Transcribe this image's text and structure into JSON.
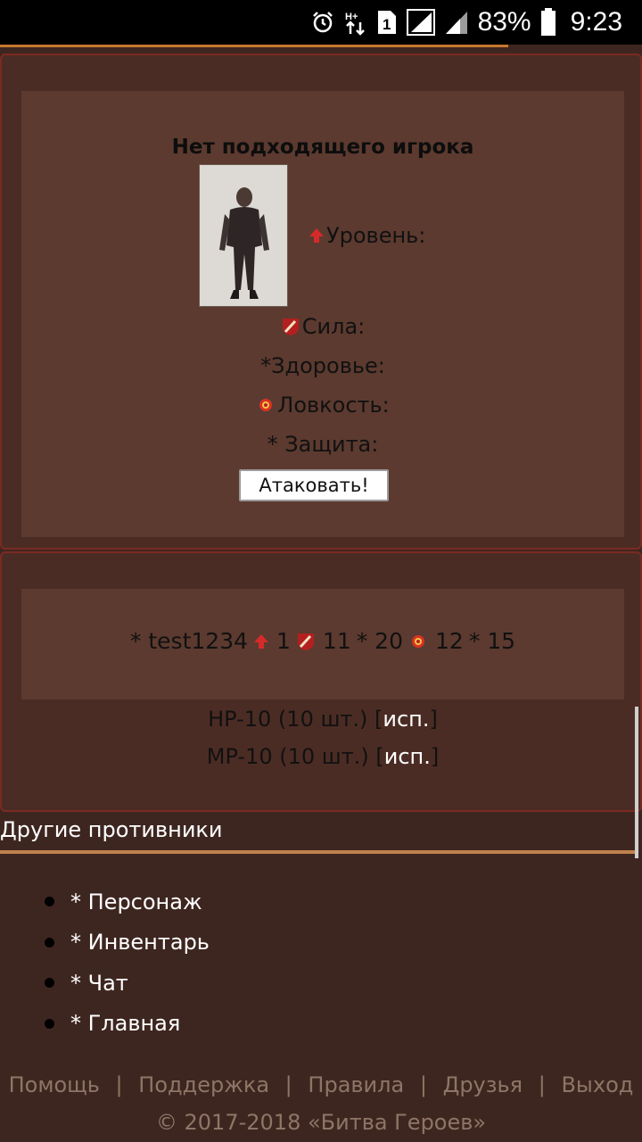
{
  "status_bar": {
    "battery": "83%",
    "time": "9:23",
    "sim_slot": "1",
    "icons": [
      "alarm-icon",
      "data-arrows-icon",
      "sim-icon",
      "signal-icon",
      "signal-icon-2",
      "battery-icon"
    ]
  },
  "opponent": {
    "title": "Нет подходящего игрока",
    "level_label": "Уровень:",
    "strength_label": "Сила:",
    "health_label": "*Здоровье:",
    "agility_label": "Ловкость:",
    "defense_label": "* Защита:",
    "attack_button": "Атаковать!"
  },
  "player": {
    "name": "* test1234",
    "level": "1",
    "strength": "11",
    "health": "* 20",
    "agility": "12",
    "defense": "* 15"
  },
  "items": [
    {
      "name": "HP-10 (10 шт.) [",
      "use": "исп.",
      "close": "]"
    },
    {
      "name": "MP-10 (10 шт.) [",
      "use": "исп.",
      "close": "]"
    }
  ],
  "others_title": "Другие противники",
  "menu": [
    "* Персонаж",
    "* Инвентарь",
    "* Чат",
    "* Главная"
  ],
  "footer": {
    "links": [
      "Помощь",
      "Поддержка",
      "Правила",
      "Друзья",
      "Выход"
    ],
    "separator": "|",
    "copyright": "© 2017-2018 «Битва Героев»"
  },
  "colors": {
    "background": "#3e2620",
    "panel": "#4b2c24",
    "inner_panel": "#5c3a2f",
    "accent": "#c0824d",
    "footer_text": "#8e7567"
  }
}
